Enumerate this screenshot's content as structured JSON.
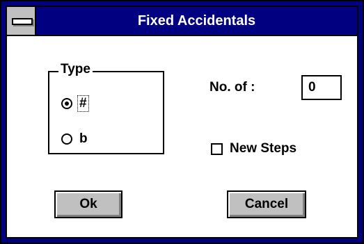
{
  "window": {
    "title": "Fixed Accidentals",
    "system_menu_icon": "system-menu-icon"
  },
  "type_group": {
    "label": "Type",
    "options": [
      {
        "label": "#",
        "selected": true,
        "focused": true
      },
      {
        "label": "b",
        "selected": false,
        "focused": false
      }
    ]
  },
  "no_of": {
    "label": "No. of :",
    "value": "0"
  },
  "new_steps": {
    "label": "New Steps",
    "checked": false
  },
  "buttons": {
    "ok_label": "Ok",
    "cancel_label": "Cancel"
  },
  "colors": {
    "titlebar": "#000080",
    "title_text": "#ffffff",
    "button_face": "#c0c0c0",
    "background": "#ffffff"
  }
}
